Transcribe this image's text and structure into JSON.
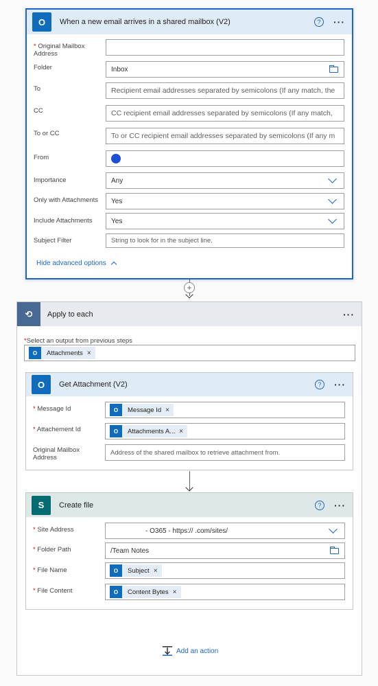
{
  "trigger": {
    "title": "When a new email arrives in a shared mailbox (V2)",
    "help": "?",
    "more": "···",
    "fields": {
      "mailbox_label": "Original Mailbox Address",
      "mailbox_value": "",
      "folder_label": "Folder",
      "folder_value": "Inbox",
      "to_label": "To",
      "to_placeholder": "Recipient email addresses separated by semicolons (If any match, the",
      "cc_label": "CC",
      "cc_placeholder": "CC recipient email addresses separated by semicolons (If any match,",
      "toorcc_label": "To or CC",
      "toorcc_placeholder": "To or CC recipient email addresses separated by semicolons (If any m",
      "from_label": "From",
      "importance_label": "Importance",
      "importance_value": "Any",
      "attachments_only_label": "Only with Attachments",
      "attachments_only_value": "Yes",
      "include_attachments_label": "Include Attachments",
      "include_attachments_value": "Yes",
      "subject_label": "Subject Filter",
      "subject_placeholder": "String to look for in the subject line."
    },
    "hide_advanced": "Hide advanced options"
  },
  "apply_each": {
    "title": "Apply to each",
    "more": "···",
    "select_label": "Select an output from previous steps",
    "token": "Attachments"
  },
  "get_attachment": {
    "title": "Get Attachment (V2)",
    "help": "?",
    "more": "···",
    "message_id_label": "Message Id",
    "message_id_token": "Message Id",
    "attachment_id_label": "Attachement Id",
    "attachment_id_token": "Attachments A...",
    "mailbox_label": "Original Mailbox Address",
    "mailbox_placeholder": "Address of the shared mailbox to retrieve attachment from."
  },
  "create_file": {
    "title": "Create file",
    "help": "?",
    "more": "···",
    "site_label": "Site Address",
    "site_value": "- O365 - https://                          .com/sites/",
    "folder_label": "Folder Path",
    "folder_value": "/Team Notes",
    "filename_label": "File Name",
    "filename_token": "Subject",
    "content_label": "File Content",
    "content_token": "Content Bytes"
  },
  "add_action": "Add an action",
  "required_mark": "*",
  "remove_mark": "×",
  "colors": {
    "accent": "#1b67c8",
    "outlook": "#0f6cbd",
    "sharepoint": "#036c70",
    "header_blue": "#dfecf8",
    "header_teal": "#dde9e8"
  },
  "icons": [
    "outlook-icon",
    "loop-icon",
    "sharepoint-icon",
    "chevron-down-icon",
    "folder-icon",
    "help-icon",
    "more-icon",
    "plus-icon",
    "add-action-icon"
  ]
}
